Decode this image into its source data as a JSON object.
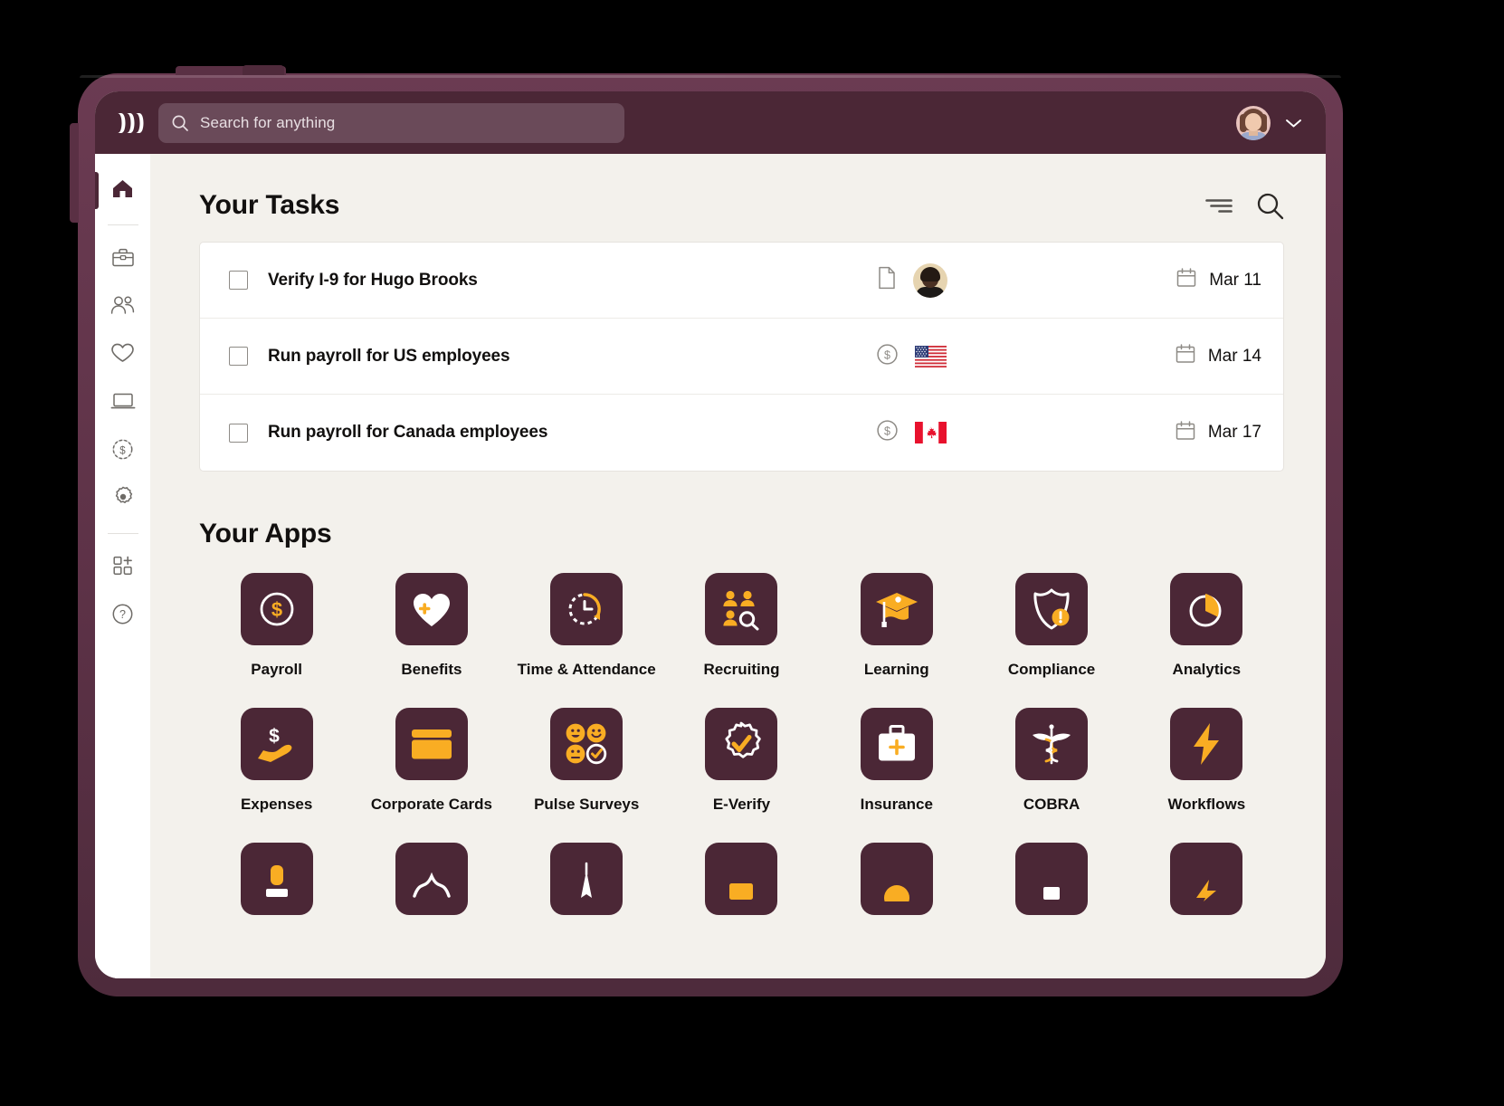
{
  "app": {
    "brand_logo": "rippling-logo-icon",
    "accent_purple": "#4b2736",
    "accent_gold": "#f9ad23",
    "page_bg": "#f3f1ec"
  },
  "topbar": {
    "search": {
      "icon": "search-icon",
      "placeholder": "Search for anything",
      "value": ""
    },
    "avatar_alt": "user-avatar",
    "chevron": "chevron-down-icon"
  },
  "sidebar": {
    "items": [
      {
        "name": "home",
        "icon": "home-icon",
        "active": true
      },
      {
        "name": "toolbox",
        "icon": "briefcase-icon",
        "active": false
      },
      {
        "name": "people",
        "icon": "people-icon",
        "active": false
      },
      {
        "name": "benefits",
        "icon": "heart-icon",
        "active": false
      },
      {
        "name": "devices",
        "icon": "laptop-icon",
        "active": false
      },
      {
        "name": "payroll",
        "icon": "dollar-clock-icon",
        "active": false
      },
      {
        "name": "settings",
        "icon": "gear-icon",
        "active": false
      },
      {
        "name": "add-app",
        "icon": "grid-plus-icon",
        "active": false
      },
      {
        "name": "help",
        "icon": "question-circle-icon",
        "active": false
      }
    ]
  },
  "tasks": {
    "title": "Your Tasks",
    "actions": [
      {
        "name": "filter",
        "icon": "filter-icon"
      },
      {
        "name": "search",
        "icon": "search-icon"
      }
    ],
    "rows": [
      {
        "label": "Verify I-9 for Hugo Brooks",
        "checked": false,
        "type_icon": "document-icon",
        "badge": "employee-avatar",
        "date": "Mar 11",
        "date_icon": "calendar-icon"
      },
      {
        "label": "Run payroll for US employees",
        "checked": false,
        "type_icon": "dollar-circle-icon",
        "badge": "flag-us",
        "date": "Mar 14",
        "date_icon": "calendar-icon"
      },
      {
        "label": "Run payroll for Canada employees",
        "checked": false,
        "type_icon": "dollar-circle-icon",
        "badge": "flag-ca",
        "date": "Mar 17",
        "date_icon": "calendar-icon"
      }
    ]
  },
  "apps": {
    "title": "Your Apps",
    "items": [
      {
        "label": "Payroll",
        "icon": "dollar-circle-icon"
      },
      {
        "label": "Benefits",
        "icon": "heart-plus-icon"
      },
      {
        "label": "Time & Attendance",
        "icon": "clock-arrow-icon"
      },
      {
        "label": "Recruiting",
        "icon": "people-search-icon"
      },
      {
        "label": "Learning",
        "icon": "graduation-cap-icon"
      },
      {
        "label": "Compliance",
        "icon": "shield-alert-icon"
      },
      {
        "label": "Analytics",
        "icon": "pie-chart-icon"
      },
      {
        "label": "Expenses",
        "icon": "hand-dollar-icon"
      },
      {
        "label": "Corporate Cards",
        "icon": "credit-card-icon"
      },
      {
        "label": "Pulse Surveys",
        "icon": "emoji-survey-icon"
      },
      {
        "label": "E-Verify",
        "icon": "badge-check-icon"
      },
      {
        "label": "Insurance",
        "icon": "medical-kit-icon"
      },
      {
        "label": "COBRA",
        "icon": "caduceus-icon"
      },
      {
        "label": "Workflows",
        "icon": "lightning-bolt-icon"
      }
    ],
    "next_row_partial": [
      {
        "icon": "app-icon-partial-1"
      },
      {
        "icon": "app-icon-partial-2"
      },
      {
        "icon": "app-icon-partial-3"
      },
      {
        "icon": "app-icon-partial-4"
      },
      {
        "icon": "app-icon-partial-5"
      },
      {
        "icon": "app-icon-partial-6"
      },
      {
        "icon": "app-icon-partial-7"
      }
    ]
  }
}
